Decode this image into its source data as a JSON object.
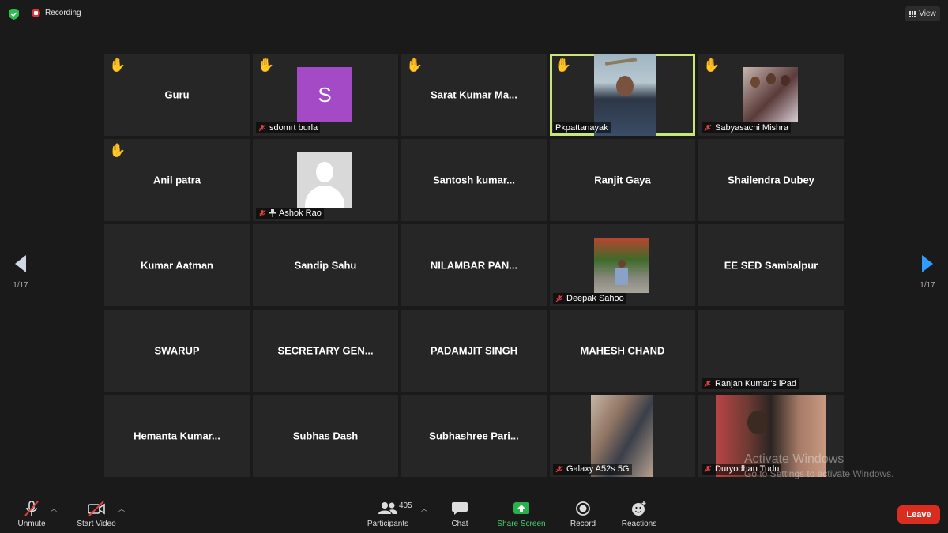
{
  "topbar": {
    "recording_label": "Recording",
    "view_label": "View"
  },
  "tiles": [
    {
      "name": "Guru",
      "hand": true
    },
    {
      "name": "sdomrt burla",
      "hand": true,
      "avatar_letter": "S"
    },
    {
      "name": "Sarat  Kumar  Ma...",
      "hand": true
    },
    {
      "name": "Pkpattanayak",
      "hand": true
    },
    {
      "name": "Sabyasachi Mishra",
      "hand": true
    },
    {
      "name": "Anil patra",
      "hand": true
    },
    {
      "name": "Ashok Rao",
      "hand": false
    },
    {
      "name": "Santosh  kumar...",
      "hand": false
    },
    {
      "name": "Ranjit Gaya",
      "hand": false
    },
    {
      "name": "Shailendra Dubey",
      "hand": false
    },
    {
      "name": "Kumar Aatman",
      "hand": false
    },
    {
      "name": "Sandip Sahu",
      "hand": false
    },
    {
      "name": "NILAMBAR  PAN...",
      "hand": false
    },
    {
      "name": "Deepak Sahoo",
      "hand": false
    },
    {
      "name": "EE SED Sambalpur",
      "hand": false
    },
    {
      "name": "SWARUP",
      "hand": false
    },
    {
      "name": "SECRETARY  GEN...",
      "hand": false
    },
    {
      "name": "PADAMJIT SINGH",
      "hand": false
    },
    {
      "name": "MAHESH CHAND",
      "hand": false
    },
    {
      "name": "Ranjan Kumar's iPad",
      "hand": false
    },
    {
      "name": "Hemanta  Kumar...",
      "hand": false
    },
    {
      "name": "Subhas Dash",
      "hand": false
    },
    {
      "name": "Subhashree  Pari...",
      "hand": false
    },
    {
      "name": "Galaxy A52s 5G",
      "hand": false
    },
    {
      "name": "Duryodhan Tudu",
      "hand": false
    }
  ],
  "pagination": {
    "left": "1/17",
    "right": "1/17"
  },
  "watermark": {
    "line1": "Activate Windows",
    "line2": "Go to Settings to activate Windows."
  },
  "toolbar": {
    "unmute": "Unmute",
    "start_video": "Start Video",
    "participants": "Participants",
    "participant_count": "405",
    "chat": "Chat",
    "share_screen": "Share Screen",
    "record": "Record",
    "reactions": "Reactions",
    "leave": "Leave"
  },
  "colors": {
    "active_speaker_border": "#c9e67a",
    "leave": "#d92d20",
    "share_green": "#45d06d",
    "hand": "#f2c11b",
    "avatar_s": "#a44ac7"
  }
}
